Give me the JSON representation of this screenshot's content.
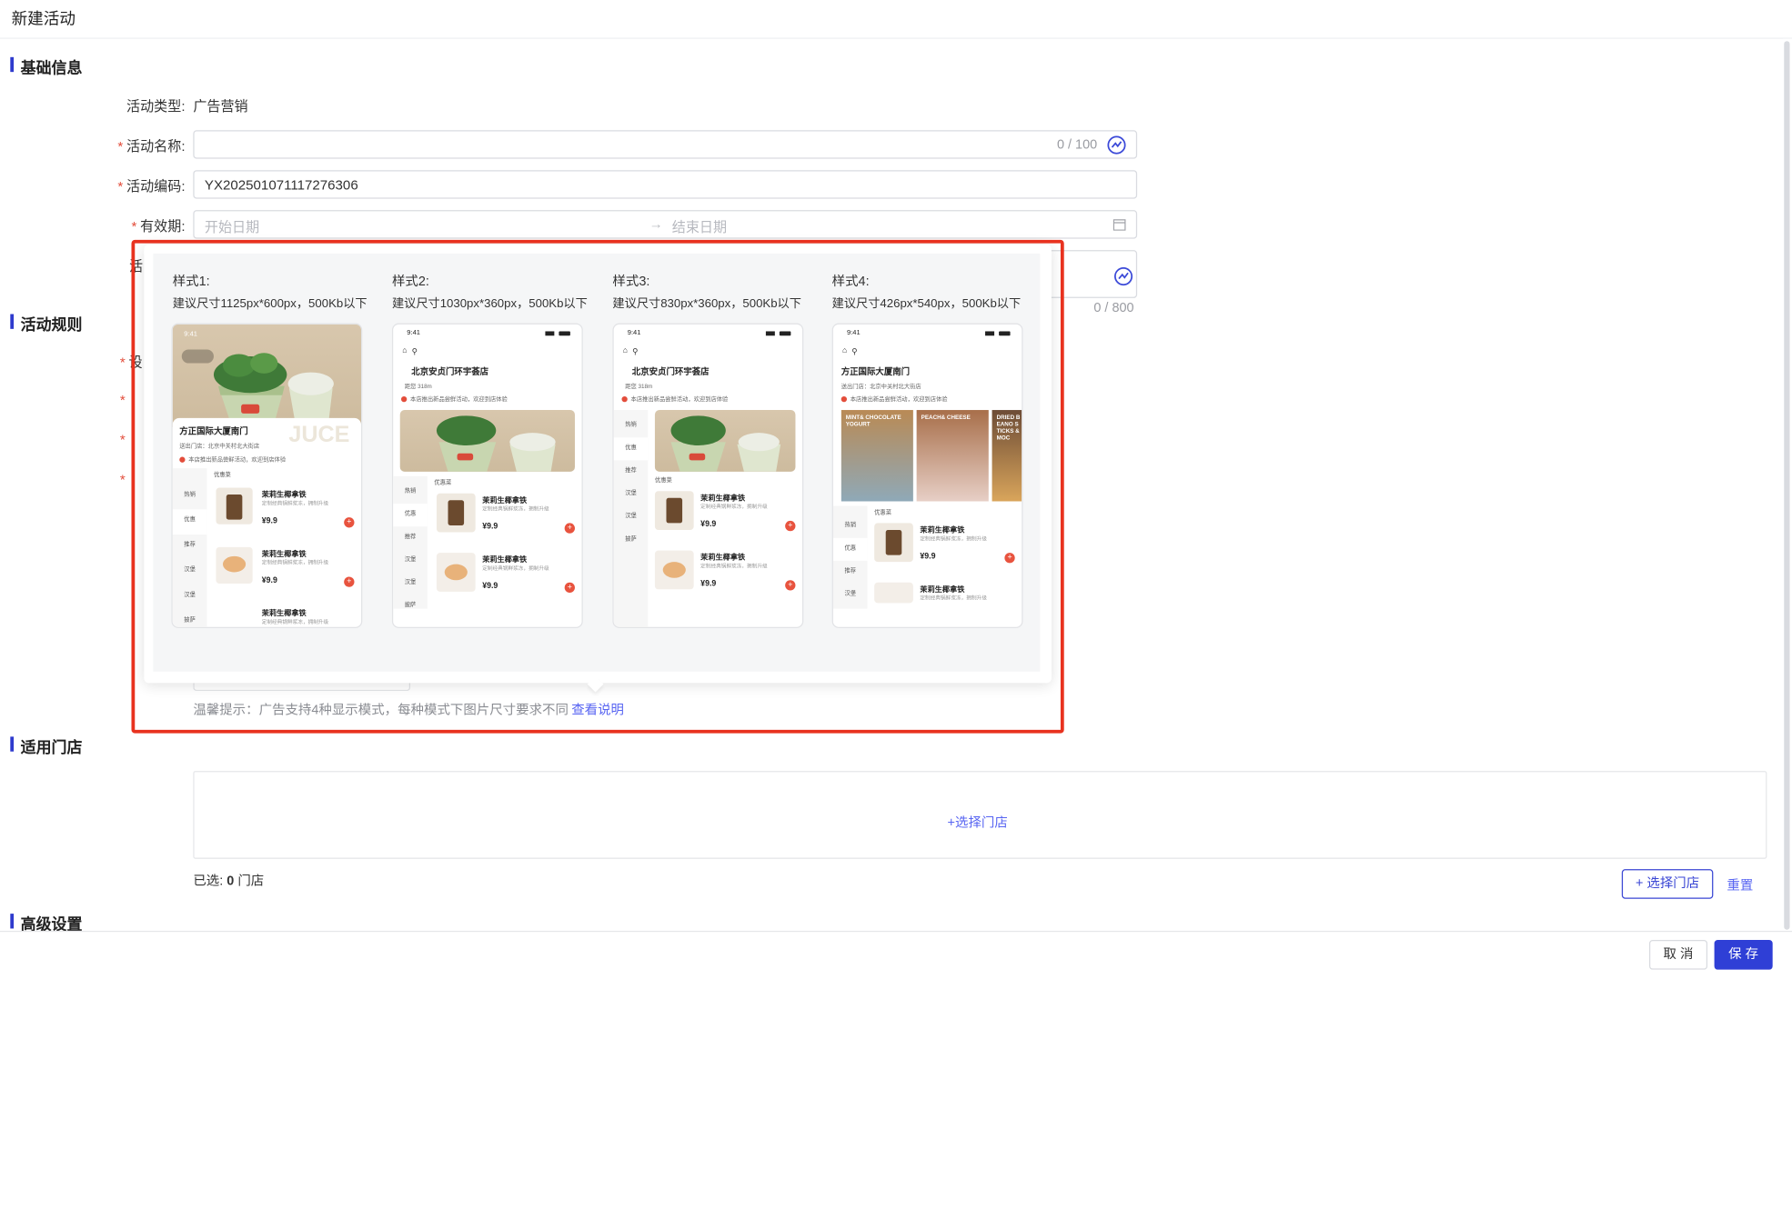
{
  "page": {
    "title": "新建活动"
  },
  "sections": {
    "basic": "基础信息",
    "rules": "活动规则",
    "stores": "适用门店",
    "advanced": "高级设置"
  },
  "form": {
    "type_label": "活动类型:",
    "type_value": "广告营销",
    "name_label": "活动名称:",
    "name_counter": "0 / 100",
    "code_label": "活动编码:",
    "code_value": "YX202501071117276306",
    "validity_label": "有效期:",
    "start_placeholder": "开始日期",
    "end_placeholder": "结束日期",
    "desc_counter": "0 / 800",
    "desc_partial_label": "活",
    "rules_partial_label": "设"
  },
  "popover": {
    "styles": [
      {
        "title": "样式1:",
        "desc": "建议尺寸1125px*600px，500Kb以下"
      },
      {
        "title": "样式2:",
        "desc": "建议尺寸1030px*360px，500Kb以下"
      },
      {
        "title": "样式3:",
        "desc": "建议尺寸830px*360px，500Kb以下"
      },
      {
        "title": "样式4:",
        "desc": "建议尺寸426px*540px，500Kb以下"
      }
    ],
    "mock": {
      "time": "9:41",
      "store_a": "方正国际大厦南门",
      "store_b": "北京安贞门环宇荟店",
      "sub_a": "送出门店：北京中关村北大街店",
      "sub_b": "距您 318m",
      "notice": "本店推出新品尝鲜活动，欢迎到店体验",
      "section_label": "优惠菜",
      "categories": [
        "热销",
        "优惠",
        "推荐",
        "汉堡",
        "汉堡",
        "披萨"
      ],
      "product_name": "茉莉生椰拿铁",
      "product_sub": "定制经典锅鲜浆冻，拥制升级",
      "price": "¥9.9",
      "banner_a": "MINT& CHOCOLATE YOGURT",
      "banner_b": "PEACH& CHEESE",
      "banner_c": "DRIED BEANO STICKS &MOC"
    }
  },
  "tip": {
    "text": "温馨提示：广告支持4种显示模式，每种模式下图片尺寸要求不同",
    "link": "查看说明"
  },
  "stores": {
    "select_center": "+选择门店",
    "selected_prefix": "已选:",
    "selected_count": "0",
    "selected_suffix": "门店",
    "select_button": "+ 选择门店",
    "reset": "重置"
  },
  "footer": {
    "cancel": "取 消",
    "save": "保 存"
  },
  "colors": {
    "accent": "#2e3acd",
    "primary_button": "#2f3fd6",
    "highlight": "#e8321f",
    "required": "#e34d3b"
  }
}
